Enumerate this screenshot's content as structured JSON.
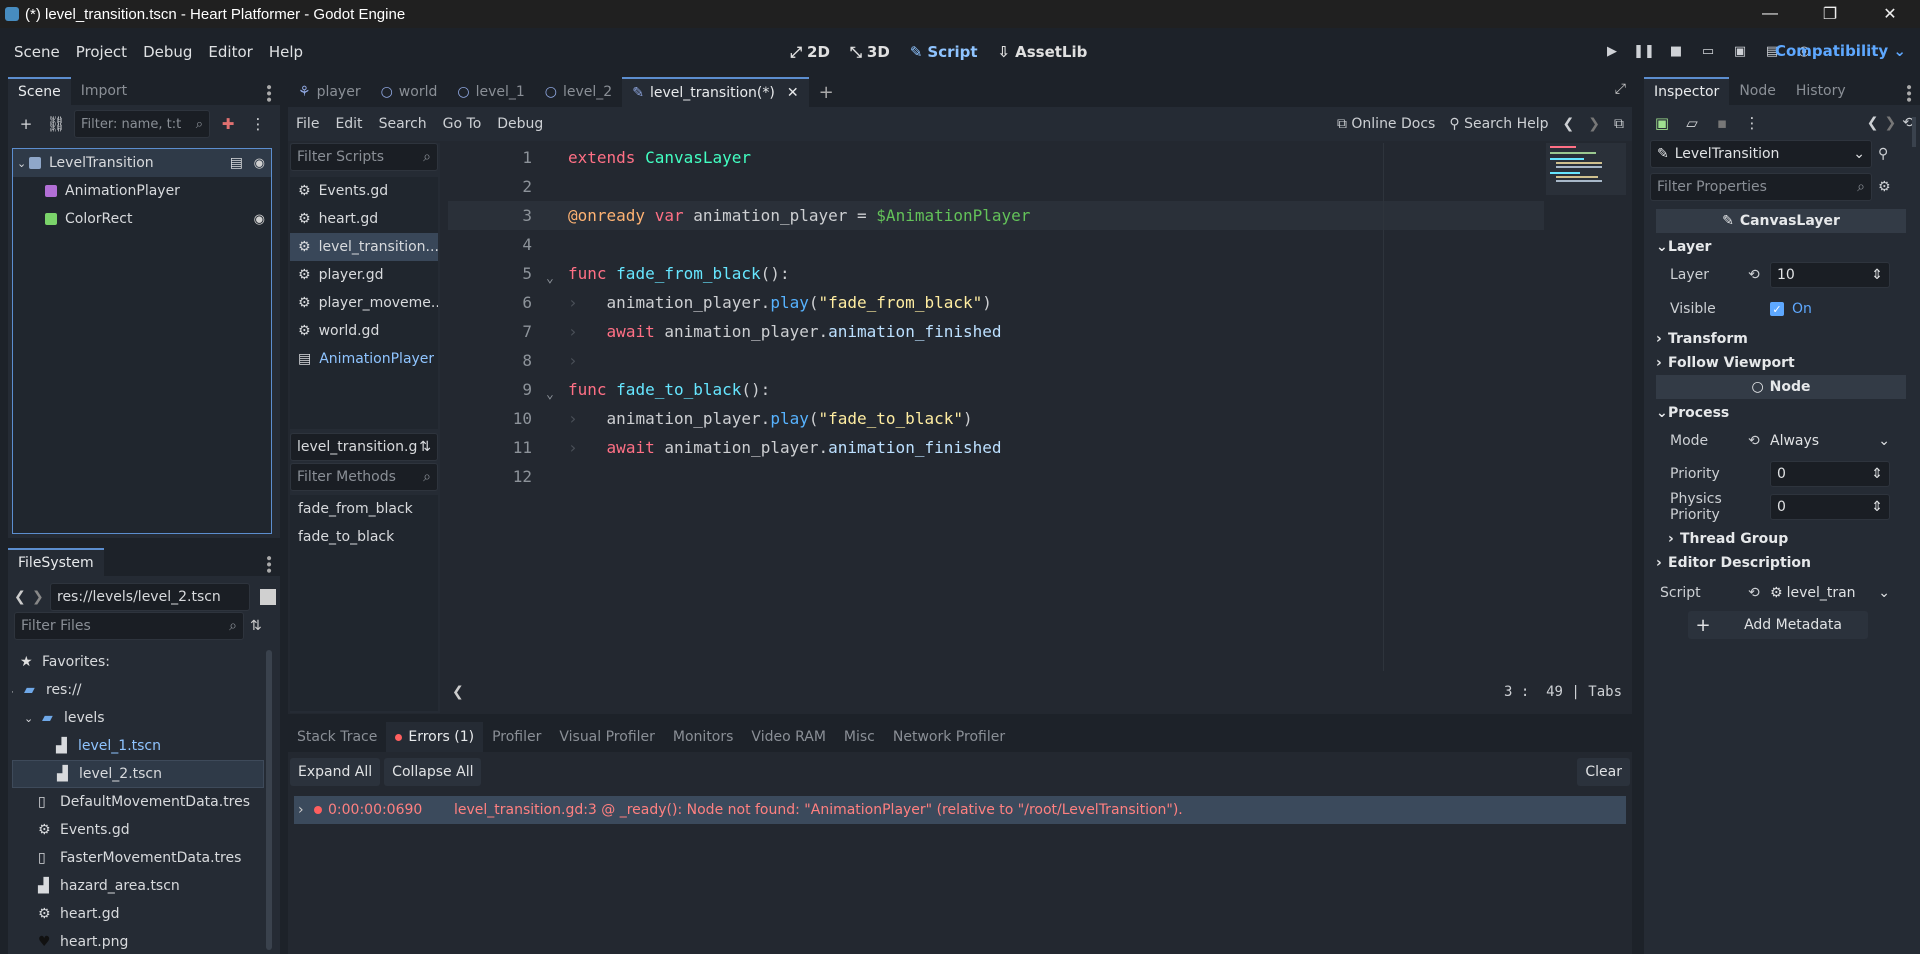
{
  "window": {
    "title": "(*) level_transition.tscn - Heart Platformer - Godot Engine",
    "controls": [
      "—",
      "❐",
      "✕"
    ]
  },
  "menubar": {
    "menus": [
      "Scene",
      "Project",
      "Debug",
      "Editor",
      "Help"
    ],
    "modes": [
      {
        "label": "2D",
        "icon": "2d-icon",
        "active": false
      },
      {
        "label": "3D",
        "icon": "3d-icon",
        "active": false
      },
      {
        "label": "Script",
        "icon": "script-icon",
        "active": true
      },
      {
        "label": "AssetLib",
        "icon": "assetlib-icon",
        "active": false
      }
    ],
    "renderer": "Compatibility"
  },
  "scene_dock": {
    "tabs": [
      "Scene",
      "Import"
    ],
    "filter_placeholder": "Filter: name, t:t",
    "nodes": [
      {
        "name": "LevelTransition",
        "icon": "canvas-layer-icon",
        "selected": true,
        "has_script": true,
        "visible_toggle": true
      },
      {
        "name": "AnimationPlayer",
        "icon": "animation-player-icon",
        "selected": false,
        "has_script": false,
        "visible_toggle": false
      },
      {
        "name": "ColorRect",
        "icon": "color-rect-icon",
        "selected": false,
        "has_script": false,
        "visible_toggle": true
      }
    ]
  },
  "filesystem": {
    "tab": "FileSystem",
    "path": "res://levels/level_2.tscn",
    "filter_placeholder": "Filter Files",
    "items": [
      {
        "label": "Favorites:",
        "icon": "star-icon",
        "indent": 0,
        "selected": false,
        "highlight": false
      },
      {
        "label": "res://",
        "icon": "folder-icon",
        "indent": 0,
        "selected": false,
        "highlight": false
      },
      {
        "label": "levels",
        "icon": "folder-icon",
        "indent": 1,
        "selected": false,
        "highlight": false
      },
      {
        "label": "level_1.tscn",
        "icon": "scene-icon",
        "indent": 2,
        "selected": false,
        "highlight": true
      },
      {
        "label": "level_2.tscn",
        "icon": "scene-icon",
        "indent": 2,
        "selected": true,
        "highlight": false
      },
      {
        "label": "DefaultMovementData.tres",
        "icon": "resource-icon",
        "indent": 1,
        "selected": false,
        "highlight": false
      },
      {
        "label": "Events.gd",
        "icon": "gear-icon",
        "indent": 1,
        "selected": false,
        "highlight": false
      },
      {
        "label": "FasterMovementData.tres",
        "icon": "resource-icon",
        "indent": 1,
        "selected": false,
        "highlight": false
      },
      {
        "label": "hazard_area.tscn",
        "icon": "scene-icon",
        "indent": 1,
        "selected": false,
        "highlight": false
      },
      {
        "label": "heart.gd",
        "icon": "gear-icon",
        "indent": 1,
        "selected": false,
        "highlight": false
      },
      {
        "label": "heart.png",
        "icon": "heart-icon",
        "indent": 1,
        "selected": false,
        "highlight": false
      }
    ]
  },
  "editor_tabs": [
    {
      "label": "player",
      "icon": "player-icon",
      "active": false
    },
    {
      "label": "world",
      "icon": "node-icon",
      "active": false
    },
    {
      "label": "level_1",
      "icon": "node-icon",
      "active": false
    },
    {
      "label": "level_2",
      "icon": "node-icon",
      "active": false
    },
    {
      "label": "level_transition(*)",
      "icon": "canvas-layer-icon",
      "active": true
    }
  ],
  "script_menu": {
    "menus": [
      "File",
      "Edit",
      "Search",
      "Go To",
      "Debug"
    ],
    "online_docs": "Online Docs",
    "search_help": "Search Help"
  },
  "script_list": {
    "filter_placeholder": "Filter Scripts",
    "items": [
      {
        "label": "Events.gd",
        "icon": "gear-icon",
        "selected": false,
        "highlight": false
      },
      {
        "label": "heart.gd",
        "icon": "gear-icon",
        "selected": false,
        "highlight": false
      },
      {
        "label": "level_transition....",
        "icon": "gear-icon",
        "selected": true,
        "highlight": false
      },
      {
        "label": "player.gd",
        "icon": "gear-icon",
        "selected": false,
        "highlight": false
      },
      {
        "label": "player_moveme...",
        "icon": "gear-icon",
        "selected": false,
        "highlight": false
      },
      {
        "label": "world.gd",
        "icon": "gear-icon",
        "selected": false,
        "highlight": false
      },
      {
        "label": "AnimationPlayer",
        "icon": "doc-icon",
        "selected": false,
        "highlight": true
      }
    ],
    "current_script": "level_transition.g",
    "methods_placeholder": "Filter Methods",
    "methods": [
      "fade_from_black",
      "fade_to_black"
    ]
  },
  "code": {
    "line_numbers": [
      "1",
      "2",
      "3",
      "4",
      "5",
      "6",
      "7",
      "8",
      "9",
      "10",
      "11",
      "12"
    ],
    "line1": {
      "kw": "extends",
      "cls": "CanvasLayer"
    },
    "line3": {
      "annot": "@onready",
      "kw": "var",
      "name": "animation_player",
      "op": "=",
      "node": "$AnimationPlayer"
    },
    "line5": {
      "kw": "func",
      "fn": "fade_from_black",
      "tail": "():"
    },
    "line6": {
      "obj": "animation_player",
      "dot": ".",
      "call": "play",
      "open": "(",
      "str": "\"fade_from_black\"",
      "close": ")"
    },
    "line7": {
      "kw": "await",
      "obj": "animation_player",
      "dot": ".",
      "member": "animation_finished"
    },
    "line9": {
      "kw": "func",
      "fn": "fade_to_black",
      "tail": "():"
    },
    "line10": {
      "obj": "animation_player",
      "dot": ".",
      "call": "play",
      "open": "(",
      "str": "\"fade_to_black\"",
      "close": ")"
    },
    "line11": {
      "kw": "await",
      "obj": "animation_player",
      "dot": ".",
      "member": "animation_finished"
    },
    "status_line": "3",
    "status_col": "49",
    "status_sep": ":",
    "status_bar": "|",
    "status_indent": "Tabs"
  },
  "bottom_panel": {
    "tabs": [
      {
        "label": "Stack Trace",
        "active": false
      },
      {
        "label": "Errors (1)",
        "active": true
      },
      {
        "label": "Profiler",
        "active": false
      },
      {
        "label": "Visual Profiler",
        "active": false
      },
      {
        "label": "Monitors",
        "active": false
      },
      {
        "label": "Video RAM",
        "active": false
      },
      {
        "label": "Misc",
        "active": false
      },
      {
        "label": "Network Profiler",
        "active": false
      }
    ],
    "expand_all": "Expand All",
    "collapse_all": "Collapse All",
    "clear": "Clear",
    "error": {
      "time": "0:00:00:0690",
      "message": "level_transition.gd:3 @ _ready(): Node not found: \"AnimationPlayer\" (relative to \"/root/LevelTransition\")."
    }
  },
  "inspector": {
    "tabs": [
      "Inspector",
      "Node",
      "History"
    ],
    "object": "LevelTransition",
    "filter_placeholder": "Filter Properties",
    "class_header": "CanvasLayer",
    "layer_section": "Layer",
    "layer_label": "Layer",
    "layer_value": "10",
    "visible_label": "Visible",
    "visible_value": "On",
    "transform_section": "Transform",
    "follow_section": "Follow Viewport",
    "node_header": "Node",
    "process_section": "Process",
    "mode_label": "Mode",
    "mode_value": "Always",
    "priority_label": "Priority",
    "priority_value": "0",
    "physics_label": "Physics Priority",
    "physics_value": "0",
    "thread_section": "Thread Group",
    "editor_desc_section": "Editor Description",
    "script_label": "Script",
    "script_value": "level_tran",
    "add_metadata": "Add Metadata"
  }
}
